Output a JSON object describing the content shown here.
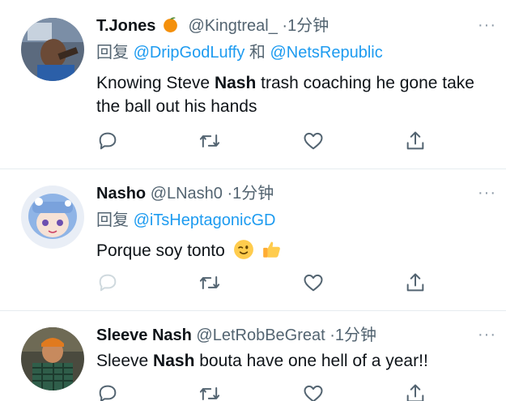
{
  "tweets": [
    {
      "name": "T.Jones",
      "handle": "@Kingtreal_",
      "time": "·1分钟",
      "reply_prefix": "回复",
      "reply_to": [
        "@DripGodLuffy",
        "@NetsRepublic"
      ],
      "reply_joiner": "和",
      "text_parts": [
        "Knowing Steve ",
        "Nash",
        " trash coaching he  gone take the ball out his hands"
      ],
      "more": "···"
    },
    {
      "name": "Nasho",
      "handle": "@LNash0",
      "time": "·1分钟",
      "reply_prefix": "回复",
      "reply_to": [
        "@iTsHeptagonicGD"
      ],
      "text": "Porque soy tonto",
      "more": "···"
    },
    {
      "name": "Sleeve Nash",
      "handle": "@LetRobBeGreat",
      "time": "·1分钟",
      "text_parts": [
        "Sleeve ",
        "Nash",
        " bouta have one hell of a year!!"
      ],
      "more": "···"
    }
  ],
  "icons": {
    "reply": "reply-icon",
    "retweet": "retweet-icon",
    "like": "like-icon",
    "share": "share-icon",
    "verified_emoji": "orange-emoji",
    "wink": "winking-face-emoji",
    "thumbs": "thumbs-up-emoji"
  },
  "colors": {
    "text": "#0f1419",
    "secondary": "#536471",
    "mention": "#1d9bf0",
    "icon": "#536471",
    "separator": "#e6ecf0"
  }
}
